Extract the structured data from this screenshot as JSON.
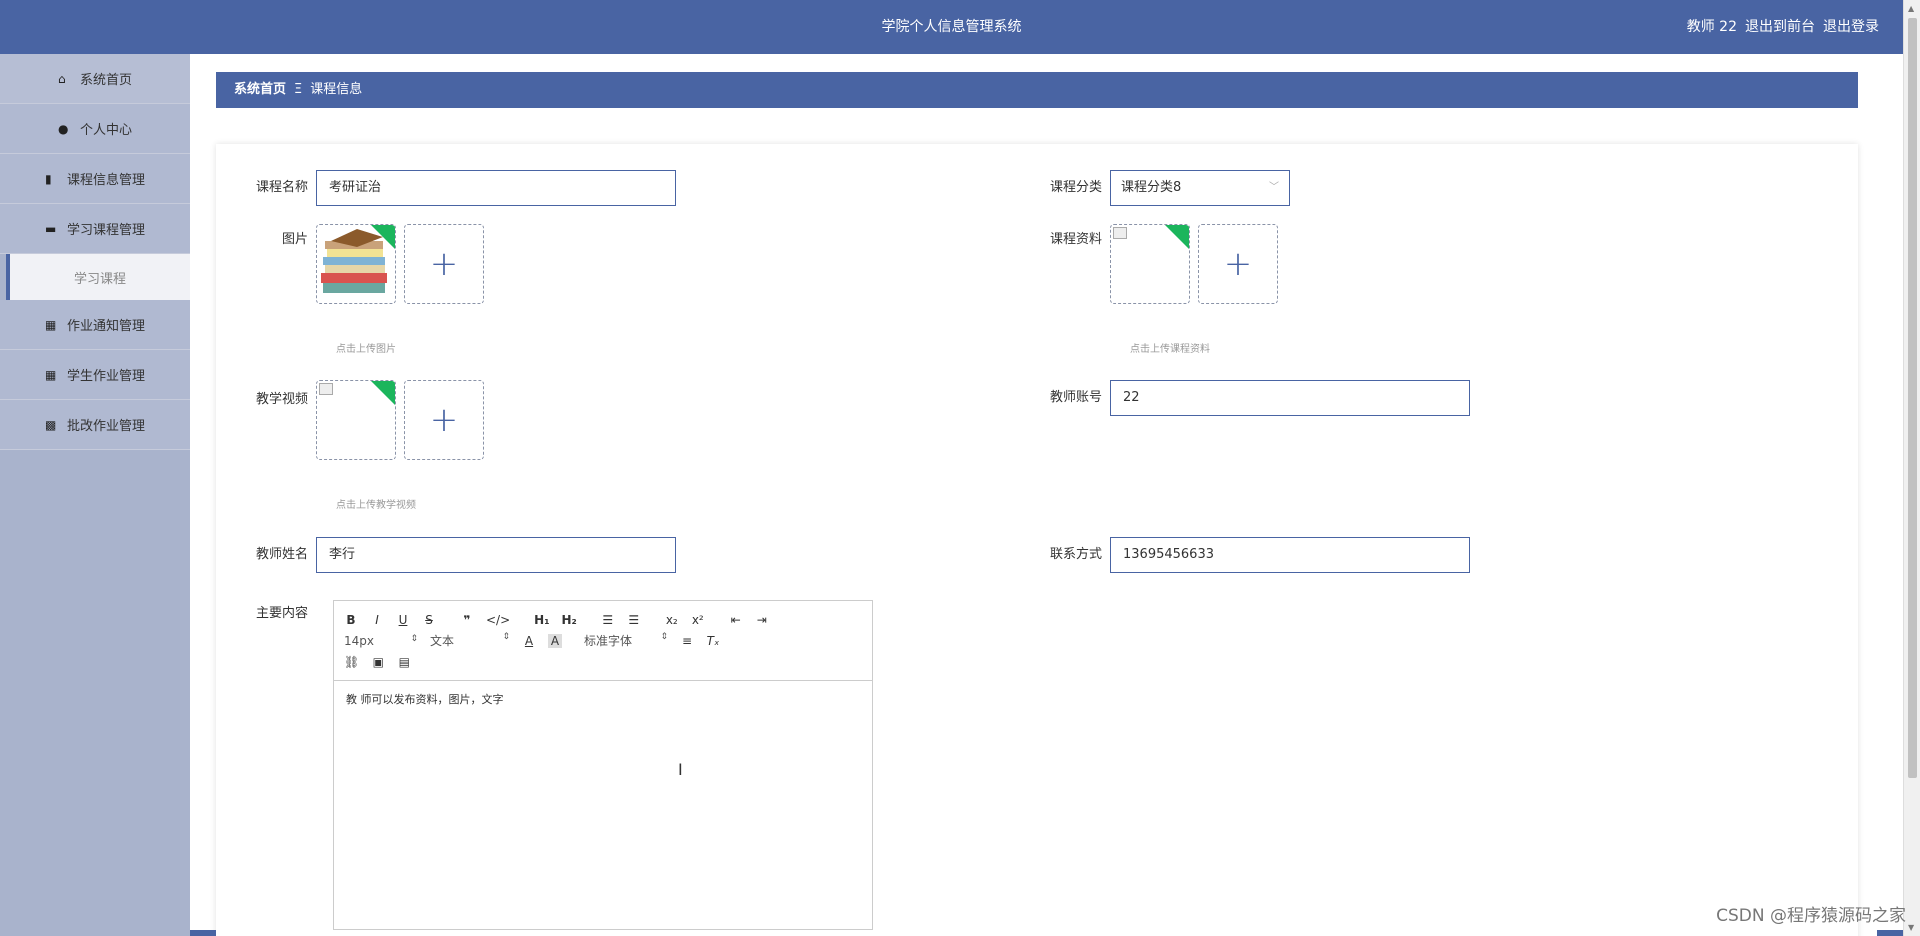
{
  "header": {
    "title": "学院个人信息管理系统",
    "user_label": "教师 22",
    "to_front_label": "退出到前台",
    "logout_label": "退出登录"
  },
  "sidebar": {
    "items": [
      {
        "label": "系统首页",
        "icon": "home-icon"
      },
      {
        "label": "个人中心",
        "icon": "user-icon"
      },
      {
        "label": "课程信息管理",
        "icon": "book-icon"
      },
      {
        "label": "学习课程管理",
        "icon": "briefcase-icon"
      },
      {
        "label": "学习课程",
        "icon": ""
      },
      {
        "label": "作业通知管理",
        "icon": "grid-icon"
      },
      {
        "label": "学生作业管理",
        "icon": "grid-icon"
      },
      {
        "label": "批改作业管理",
        "icon": "apps-icon"
      }
    ]
  },
  "breadcrumb": {
    "home": "系统首页",
    "separator": "Ξ",
    "current": "课程信息"
  },
  "form": {
    "course_name": {
      "label": "课程名称",
      "value": "考研证治"
    },
    "course_category": {
      "label": "课程分类",
      "value": "课程分类8"
    },
    "image": {
      "label": "图片",
      "hint": "点击上传图片"
    },
    "material": {
      "label": "课程资料",
      "hint": "点击上传课程资料"
    },
    "video": {
      "label": "教学视频",
      "hint": "点击上传教学视频"
    },
    "teacher_account": {
      "label": "教师账号",
      "value": "22"
    },
    "teacher_name": {
      "label": "教师姓名",
      "value": "李行"
    },
    "contact": {
      "label": "联系方式",
      "value": "13695456633"
    },
    "main_content": {
      "label": "主要内容",
      "text": "教 师可以发布资料，图片，文字"
    }
  },
  "editor": {
    "size": "14px",
    "text_style": "文本",
    "font": "标准字体"
  },
  "watermark": "CSDN @程序猿源码之家",
  "colors": {
    "primary": "#4964a3",
    "sidebar": "#b0b9d1",
    "corner_badge": "#1bb55c"
  }
}
